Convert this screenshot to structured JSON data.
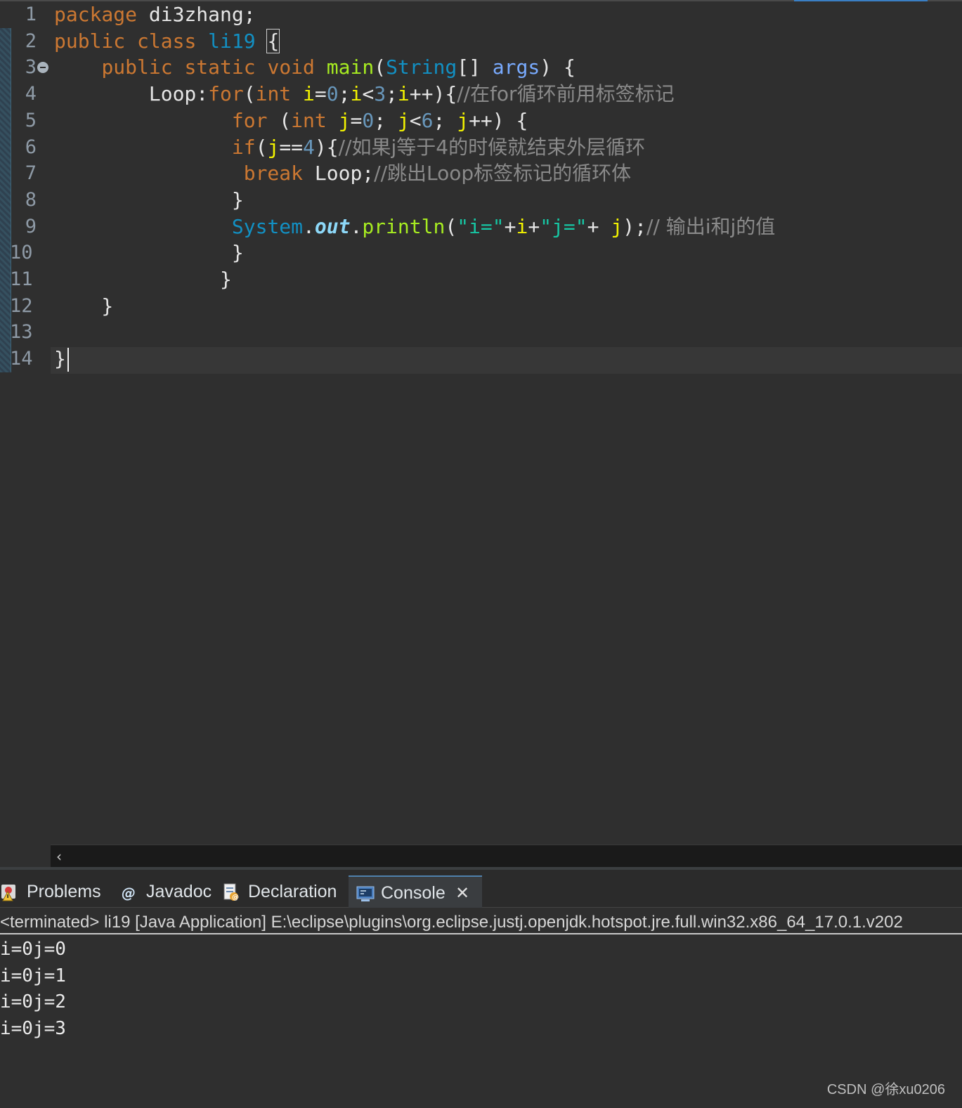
{
  "editor": {
    "line_numbers": [
      "1",
      "2",
      "3",
      "4",
      "5",
      "6",
      "7",
      "8",
      "9",
      "10",
      "11",
      "12",
      "13",
      "14"
    ],
    "lines": [
      [
        {
          "c": "kw",
          "t": "package"
        },
        {
          "c": "pl",
          "t": " di3zhang;"
        }
      ],
      [
        {
          "c": "kw",
          "t": "public"
        },
        {
          "c": "pl",
          "t": " "
        },
        {
          "c": "kw",
          "t": "class"
        },
        {
          "c": "pl",
          "t": " "
        },
        {
          "c": "ty",
          "t": "li19"
        },
        {
          "c": "pl",
          "t": " "
        },
        {
          "c": "pl br-box",
          "t": "{"
        }
      ],
      [
        {
          "c": "pl",
          "t": "    "
        },
        {
          "c": "kw",
          "t": "public"
        },
        {
          "c": "pl",
          "t": " "
        },
        {
          "c": "kw",
          "t": "static"
        },
        {
          "c": "pl",
          "t": " "
        },
        {
          "c": "kw",
          "t": "void"
        },
        {
          "c": "pl",
          "t": " "
        },
        {
          "c": "mn",
          "t": "main"
        },
        {
          "c": "pl",
          "t": "("
        },
        {
          "c": "ty",
          "t": "String"
        },
        {
          "c": "pl",
          "t": "[] "
        },
        {
          "c": "pa",
          "t": "args"
        },
        {
          "c": "pl",
          "t": ") {"
        }
      ],
      [
        {
          "c": "pl",
          "t": "        Loop:"
        },
        {
          "c": "kw",
          "t": "for"
        },
        {
          "c": "pl",
          "t": "("
        },
        {
          "c": "kw",
          "t": "int"
        },
        {
          "c": "pl",
          "t": " "
        },
        {
          "c": "vr",
          "t": "i"
        },
        {
          "c": "pl",
          "t": "="
        },
        {
          "c": "nu",
          "t": "0"
        },
        {
          "c": "pl",
          "t": ";"
        },
        {
          "c": "vr",
          "t": "i"
        },
        {
          "c": "pl",
          "t": "<"
        },
        {
          "c": "nu",
          "t": "3"
        },
        {
          "c": "pl",
          "t": ";"
        },
        {
          "c": "vr",
          "t": "i"
        },
        {
          "c": "pl",
          "t": "++){"
        },
        {
          "c": "cm",
          "t": "//在for循环前用标签标记"
        }
      ],
      [
        {
          "c": "pl",
          "t": "               "
        },
        {
          "c": "kw",
          "t": "for"
        },
        {
          "c": "pl",
          "t": " ("
        },
        {
          "c": "kw",
          "t": "int"
        },
        {
          "c": "pl",
          "t": " "
        },
        {
          "c": "vr",
          "t": "j"
        },
        {
          "c": "pl",
          "t": "="
        },
        {
          "c": "nu",
          "t": "0"
        },
        {
          "c": "pl",
          "t": "; "
        },
        {
          "c": "vr",
          "t": "j"
        },
        {
          "c": "pl",
          "t": "<"
        },
        {
          "c": "nu",
          "t": "6"
        },
        {
          "c": "pl",
          "t": "; "
        },
        {
          "c": "vr",
          "t": "j"
        },
        {
          "c": "pl",
          "t": "++) {"
        }
      ],
      [
        {
          "c": "pl",
          "t": "               "
        },
        {
          "c": "kw",
          "t": "if"
        },
        {
          "c": "pl",
          "t": "("
        },
        {
          "c": "vr",
          "t": "j"
        },
        {
          "c": "pl",
          "t": "=="
        },
        {
          "c": "nu",
          "t": "4"
        },
        {
          "c": "pl",
          "t": "){"
        },
        {
          "c": "cm",
          "t": "//如果j等于4的时候就结束外层循环"
        }
      ],
      [
        {
          "c": "pl",
          "t": "                "
        },
        {
          "c": "kw",
          "t": "break"
        },
        {
          "c": "pl",
          "t": " Loop;"
        },
        {
          "c": "cm",
          "t": "//跳出Loop标签标记的循环体"
        }
      ],
      [
        {
          "c": "pl",
          "t": "               }"
        }
      ],
      [
        {
          "c": "pl",
          "t": "               "
        },
        {
          "c": "ty",
          "t": "System"
        },
        {
          "c": "pl",
          "t": "."
        },
        {
          "c": "fi",
          "t": "out"
        },
        {
          "c": "pl",
          "t": "."
        },
        {
          "c": "mn",
          "t": "println"
        },
        {
          "c": "pl",
          "t": "("
        },
        {
          "c": "st",
          "t": "\"i=\""
        },
        {
          "c": "pl",
          "t": "+"
        },
        {
          "c": "vr",
          "t": "i"
        },
        {
          "c": "pl",
          "t": "+"
        },
        {
          "c": "st",
          "t": "\"j=\""
        },
        {
          "c": "pl",
          "t": "+ "
        },
        {
          "c": "vr",
          "t": "j"
        },
        {
          "c": "pl",
          "t": ");"
        },
        {
          "c": "cm",
          "t": "// 输出i和j的值"
        }
      ],
      [
        {
          "c": "pl",
          "t": "               }"
        }
      ],
      [
        {
          "c": "pl",
          "t": "              }"
        }
      ],
      [
        {
          "c": "pl",
          "t": "    }"
        }
      ],
      [],
      [
        {
          "c": "pl",
          "t": "}"
        }
      ]
    ]
  },
  "panel": {
    "tabs": {
      "problems": "Problems",
      "javadoc": "Javadoc",
      "declaration": "Declaration",
      "console": "Console"
    },
    "console_header": "<terminated> li19 [Java Application] E:\\eclipse\\plugins\\org.eclipse.justj.openjdk.hotspot.jre.full.win32.x86_64_17.0.1.v202",
    "output": [
      "i=0j=0",
      "i=0j=1",
      "i=0j=2",
      "i=0j=3"
    ]
  },
  "watermark": "CSDN @徐xu0206",
  "colors": {
    "background": "#2f2f2f",
    "keyword": "#cc7832",
    "type": "#1290c3",
    "method": "#a7ec21",
    "variable": "#f2f200",
    "string": "#17c6a3",
    "comment": "#8a8a8a"
  },
  "icons": {
    "scroll_left": "‹",
    "close": "✕"
  }
}
